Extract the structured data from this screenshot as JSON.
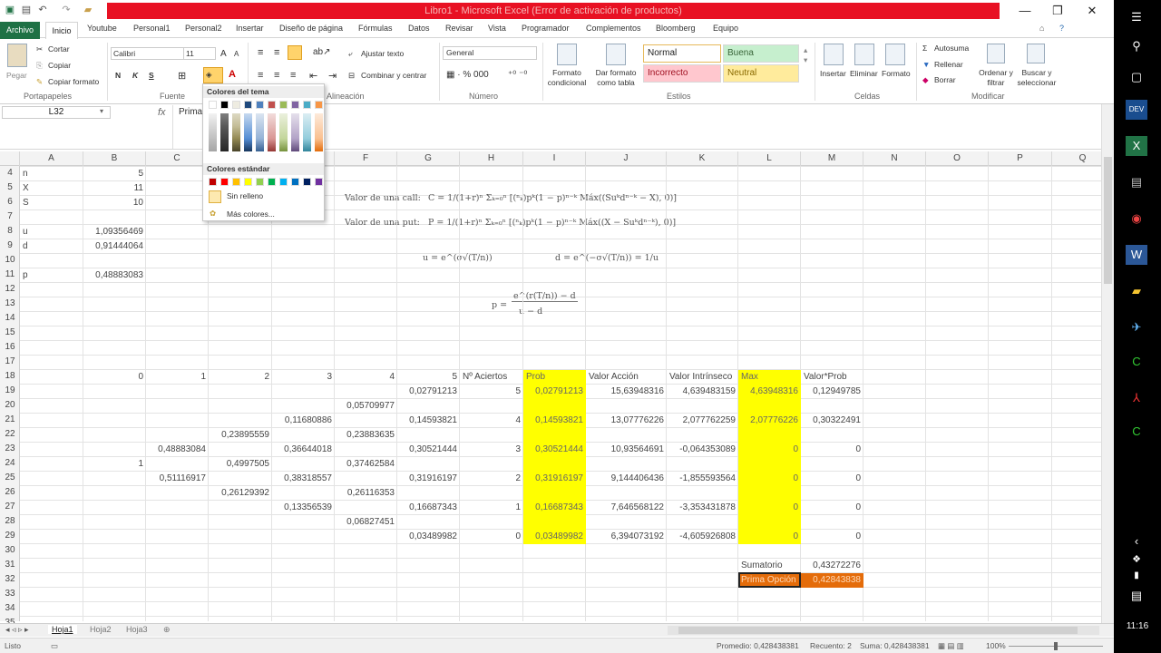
{
  "window": {
    "title": "Libro1 - Microsoft Excel (Error de activación de productos)",
    "min": "—",
    "max": "❐",
    "close": "✕",
    "help_icon": "?"
  },
  "tabs": [
    "Archivo",
    "Inicio",
    "Youtube",
    "Personal1",
    "Personal2",
    "Insertar",
    "Diseño de página",
    "Fórmulas",
    "Datos",
    "Revisar",
    "Vista",
    "Programador",
    "Complementos",
    "Bloomberg",
    "Equipo"
  ],
  "ribbon": {
    "clipboard": {
      "paste": "Pegar",
      "cut": "Cortar",
      "copy": "Copiar",
      "format_painter": "Copiar formato",
      "label": "Portapapeles"
    },
    "font": {
      "name": "Calibri",
      "size": "11",
      "grow": "A",
      "shrink": "A",
      "bold": "N",
      "italic": "K",
      "underline": "S",
      "label": "Fuente"
    },
    "align": {
      "wrap": "Ajustar texto",
      "merge": "Combinar y centrar",
      "label": "Alineación"
    },
    "number": {
      "format": "General",
      "label": "Número"
    },
    "styles": {
      "cond": "Formato condicional",
      "table": "Dar formato como tabla",
      "normal": "Normal",
      "buena": "Buena",
      "incorrecto": "Incorrecto",
      "neutral": "Neutral",
      "label": "Estilos"
    },
    "cells": {
      "insert": "Insertar",
      "delete": "Eliminar",
      "format": "Formato",
      "label": "Celdas"
    },
    "editing": {
      "autosum": "Autosuma",
      "fill": "Rellenar",
      "clear": "Borrar",
      "sort": "Ordenar y filtrar",
      "find": "Buscar y seleccionar",
      "label": "Modificar"
    }
  },
  "formula_bar": {
    "namebox": "L32",
    "fx": "fx",
    "content": "Prima"
  },
  "color_popup": {
    "theme_header": "Colores del tema",
    "standard_header": "Colores estándar",
    "no_fill": "Sin relleno",
    "more_colors": "Más colores...",
    "theme_top": [
      "#ffffff",
      "#000000",
      "#eeece1",
      "#1f497d",
      "#4f81bd",
      "#c0504d",
      "#9bbb59",
      "#8064a2",
      "#4bacc6",
      "#f79646"
    ],
    "standard": [
      "#c00000",
      "#ff0000",
      "#ffc000",
      "#ffff00",
      "#92d050",
      "#00b050",
      "#00b0f0",
      "#0070c0",
      "#002060",
      "#7030a0"
    ]
  },
  "columns": [
    "A",
    "B",
    "C",
    "D",
    "E",
    "F",
    "G",
    "H",
    "I",
    "J",
    "K",
    "L",
    "M",
    "N",
    "O",
    "P",
    "Q"
  ],
  "rows": [
    "4",
    "5",
    "6",
    "7",
    "8",
    "9",
    "10",
    "11",
    "12",
    "13",
    "14",
    "15",
    "16",
    "17",
    "18",
    "19",
    "20",
    "21",
    "22",
    "23",
    "24",
    "25",
    "26",
    "27",
    "28",
    "29",
    "30",
    "31",
    "32",
    "33",
    "34",
    "35"
  ],
  "cells": {
    "A4": "n",
    "B4": "5",
    "A5": "X",
    "B5": "11",
    "A6": "S",
    "B6": "10",
    "A8": "u",
    "B8": "1,09356469",
    "A9": "d",
    "B9": "0,91444064",
    "A11": "p",
    "B11": "0,48883083",
    "B18": "0",
    "C18": "1",
    "D18": "2",
    "E18": "3",
    "F18": "4",
    "G18": "5",
    "H18": "Nº Aciertos",
    "I18": "Prob",
    "J18": "Valor Acción",
    "K18": "Valor Intrínseco",
    "L18": "Max",
    "M18": "Valor*Prob",
    "G19": "0,02791213",
    "H19": "5",
    "I19": "0,02791213",
    "J19": "15,63948316",
    "K19": "4,639483159",
    "L19": "4,63948316",
    "M19": "0,12949785",
    "F20": "0,05709977",
    "E21": "0,11680886",
    "G21": "0,14593821",
    "H21": "4",
    "I21": "0,14593821",
    "J21": "13,07776226",
    "K21": "2,077762259",
    "L21": "2,07776226",
    "M21": "0,30322491",
    "D22": "0,23895559",
    "F22": "0,23883635",
    "C23": "0,48883084",
    "E23": "0,36644018",
    "G23": "0,30521444",
    "H23": "3",
    "I23": "0,30521444",
    "J23": "10,93564691",
    "K23": "-0,064353089",
    "L23": "0",
    "M23": "0",
    "B24": "1",
    "D24": "0,4997505",
    "F24": "0,37462584",
    "C25": "0,51116917",
    "E25": "0,38318557",
    "G25": "0,31916197",
    "H25": "2",
    "I25": "0,31916197",
    "J25": "9,144406436",
    "K25": "-1,855593564",
    "L25": "0",
    "M25": "0",
    "D26": "0,26129392",
    "F26": "0,26116353",
    "E27": "0,13356539",
    "G27": "0,16687343",
    "H27": "1",
    "I27": "0,16687343",
    "J27": "7,646568122",
    "K27": "-3,353431878",
    "L27": "0",
    "M27": "0",
    "F28": "0,06827451",
    "G29": "0,03489982",
    "H29": "0",
    "I29": "0,03489982",
    "J29": "6,394073192",
    "K29": "-4,605926808",
    "L29": "0",
    "M29": "0",
    "L31": "Sumatorio",
    "M31": "0,43272276",
    "L32": "Prima Opción",
    "M32": "0,42843838"
  },
  "formulas": {
    "call_label": "Valor de una call:",
    "call": "C = 1/(1+r)ⁿ Σₖ₌₀ⁿ [(ⁿₖ)pᵏ(1 − p)ⁿ⁻ᵏ Máx((Suᵏdⁿ⁻ᵏ − X), 0)]",
    "put_label": "Valor de una put:",
    "put": "P = 1/(1+r)ⁿ Σₖ₌₀ⁿ [(ⁿₖ)pᵏ(1 − p)ⁿ⁻ᵏ Máx((X − Suᵏdⁿ⁻ᵏ), 0)]",
    "u": "u = e^(σ√(T/n))",
    "d": "d = e^(−σ√(T/n)) = 1/u",
    "p_num": "e^(r(T/n)) − d",
    "p_lhs": "p =",
    "p_den": "u − d"
  },
  "sheets": [
    "Hoja1",
    "Hoja2",
    "Hoja3"
  ],
  "status": {
    "ready": "Listo",
    "average": "Promedio: 0,428438381",
    "count": "Recuento: 2",
    "sum": "Suma: 0,428438381",
    "zoom": "100%"
  },
  "taskbar": {
    "time": "11:16"
  }
}
